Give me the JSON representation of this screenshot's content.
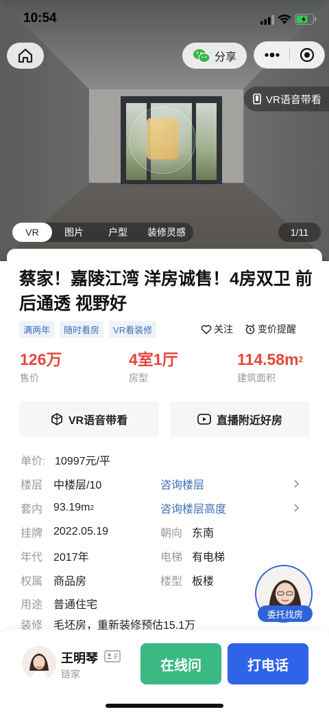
{
  "status": {
    "time": "10:54"
  },
  "topbar": {
    "share_label": "分享"
  },
  "hero": {
    "vr_guide_label": "VR语音带看",
    "tabs": [
      {
        "label": "VR",
        "active": true
      },
      {
        "label": "图片",
        "active": false
      },
      {
        "label": "户型",
        "active": false
      },
      {
        "label": "装修灵感",
        "active": false
      }
    ],
    "counter": "1/11"
  },
  "listing": {
    "title": "蔡家！嘉陵江湾 洋房诚售！4房双卫 前后通透 视野好",
    "tags": [
      "满两年",
      "随时看房",
      "VR看装修"
    ],
    "follow_label": "关注",
    "price_alert_label": "变价提醒",
    "stats": {
      "price": {
        "value": "126万",
        "label": "售价"
      },
      "layout": {
        "value": "4室1厅",
        "label": "房型"
      },
      "area": {
        "value": "114.58m",
        "sup": "2",
        "label": "建筑面积"
      }
    },
    "actions": {
      "vr_guide": "VR语音带看",
      "live_nearby": "直播附近好房"
    },
    "unit_price": {
      "key": "单价:",
      "value": "10997元/平"
    },
    "details": {
      "floor": {
        "key": "楼层",
        "value": "中楼层/10",
        "link": "咨询楼层"
      },
      "inner": {
        "key": "套内",
        "value": "93.19",
        "sup": "2",
        "unit": "m",
        "link": "咨询楼层高度"
      },
      "listed": {
        "key": "挂牌",
        "value": "2022.05.19"
      },
      "orientation": {
        "key": "朝向",
        "value": "东南"
      },
      "year": {
        "key": "年代",
        "value": "2017年"
      },
      "elevator": {
        "key": "电梯",
        "value": "有电梯"
      },
      "ownership": {
        "key": "权属",
        "value": "商品房"
      },
      "building_type": {
        "key": "楼型",
        "value": "板楼"
      },
      "usage": {
        "key": "用途",
        "value": "普通住宅"
      },
      "decoration": {
        "key": "装修",
        "value": "毛坯房，重新装修预估15.1万"
      }
    },
    "entrust_label": "委托找房"
  },
  "agent": {
    "name": "王明琴",
    "company": "链家",
    "chat_label": "在线问",
    "call_label": "打电话"
  },
  "colors": {
    "accent_red": "#e6453b",
    "link_blue": "#3f6fb5",
    "chat_green": "#3bb982",
    "call_blue": "#2f63e8"
  }
}
